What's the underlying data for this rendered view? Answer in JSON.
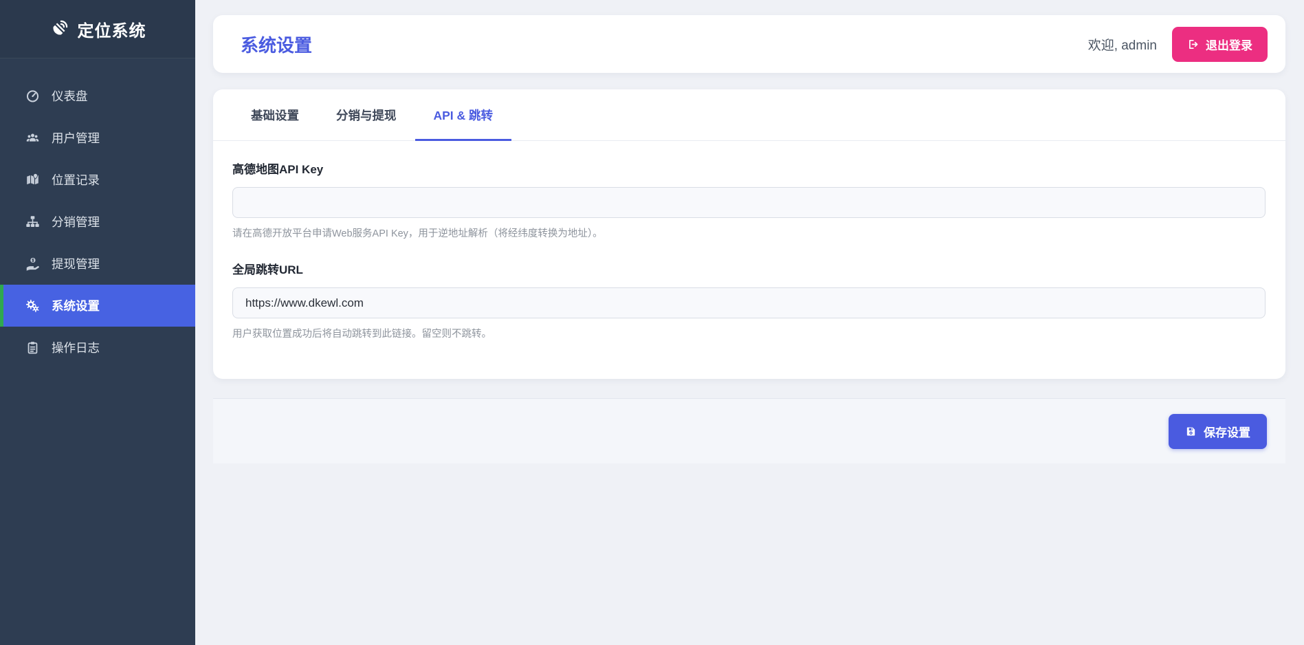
{
  "colors": {
    "sidebar_bg": "#2e3d52",
    "active_item_bg": "#4762e2",
    "active_item_accent": "#2fa84f",
    "accent_indigo": "#4a5be0",
    "logout_pink": "#ec2e81",
    "page_bg": "#eff1f6"
  },
  "sidebar": {
    "logo": "定位系统",
    "items": [
      {
        "label": "仪表盘",
        "icon": "gauge-icon",
        "active": false
      },
      {
        "label": "用户管理",
        "icon": "users-icon",
        "active": false
      },
      {
        "label": "位置记录",
        "icon": "map-marker-icon",
        "active": false
      },
      {
        "label": "分销管理",
        "icon": "sitemap-icon",
        "active": false
      },
      {
        "label": "提现管理",
        "icon": "hand-dollar-icon",
        "active": false
      },
      {
        "label": "系统设置",
        "icon": "gears-icon",
        "active": true
      },
      {
        "label": "操作日志",
        "icon": "clipboard-icon",
        "active": false
      }
    ]
  },
  "header": {
    "title": "系统设置",
    "welcome": "欢迎, admin",
    "logout_label": "退出登录"
  },
  "tabs": [
    {
      "label": "基础设置",
      "active": false
    },
    {
      "label": "分销与提现",
      "active": false
    },
    {
      "label": "API & 跳转",
      "active": true
    }
  ],
  "form": {
    "amap": {
      "label": "高德地图API Key",
      "value": "",
      "help": "请在高德开放平台申请Web服务API Key，用于逆地址解析（将经纬度转换为地址）。"
    },
    "redirect": {
      "label": "全局跳转URL",
      "value": "https://www.dkewl.com",
      "help": "用户获取位置成功后将自动跳转到此链接。留空则不跳转。"
    }
  },
  "footer": {
    "save_label": "保存设置"
  }
}
